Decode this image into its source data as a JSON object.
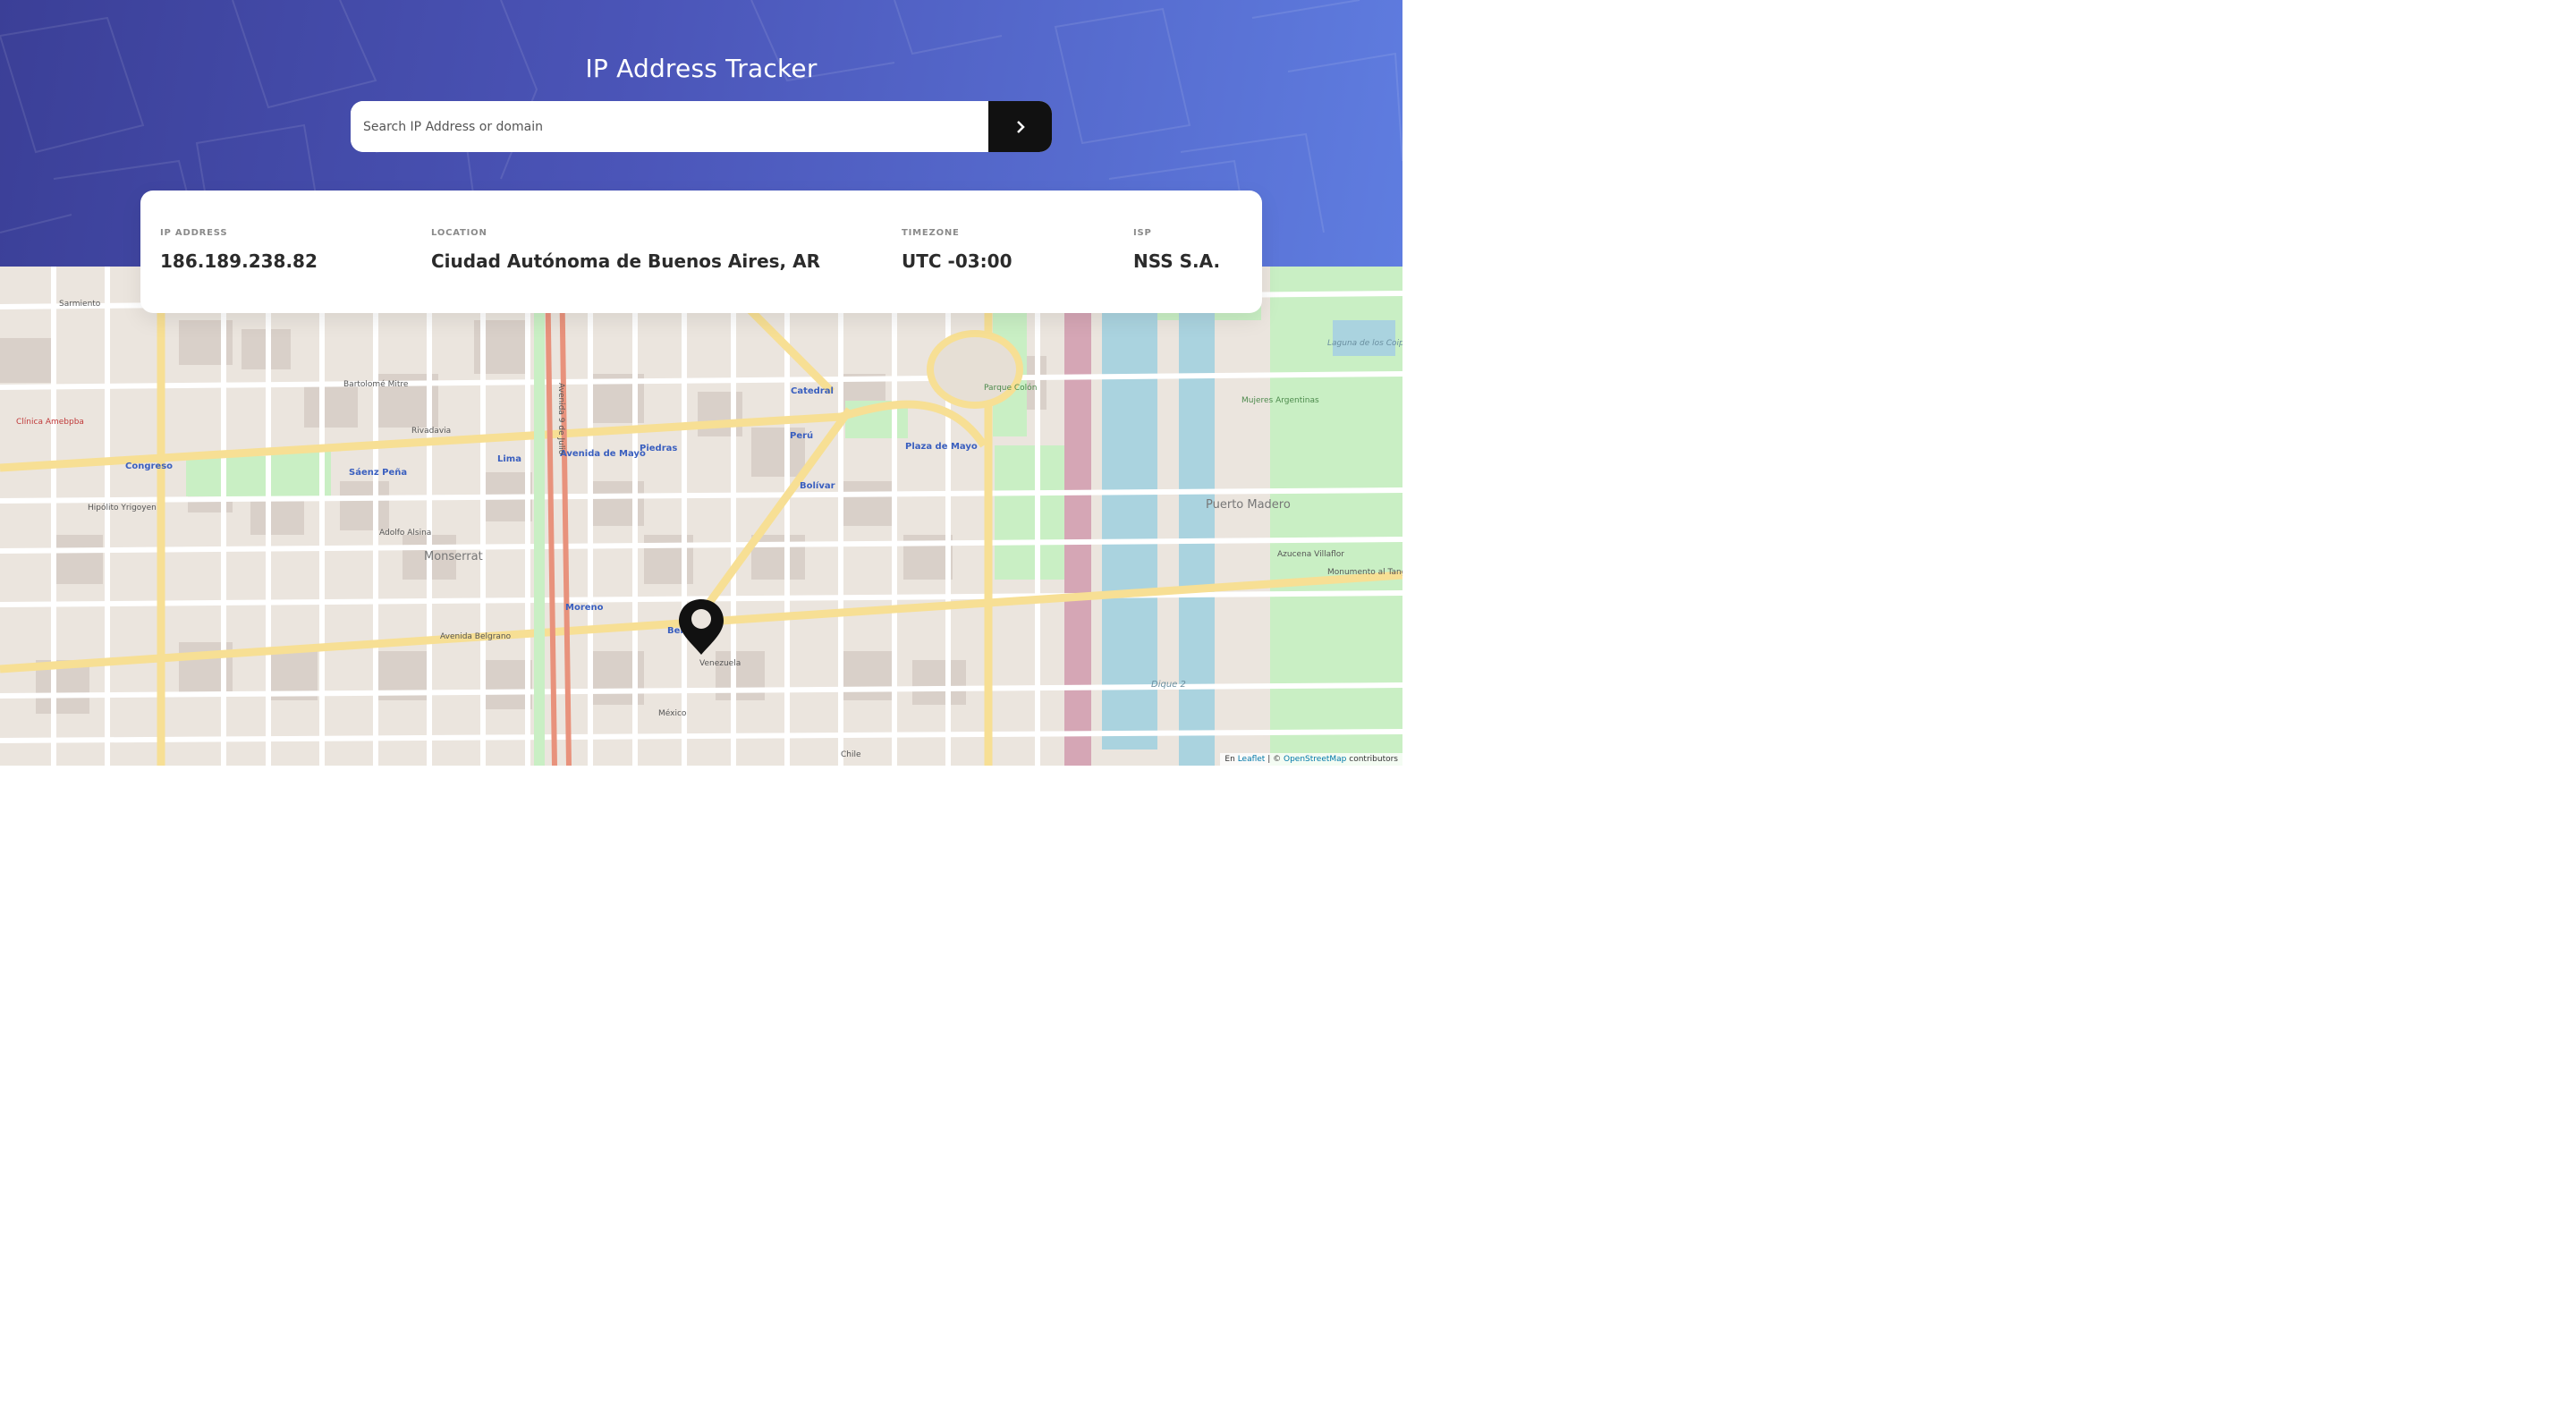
{
  "header": {
    "title": "IP Address Tracker",
    "search_placeholder": "Search IP Address or domain",
    "search_value": "",
    "submit_icon": "chevron-right-icon"
  },
  "info": {
    "ip": {
      "label": "IP Address",
      "value": "186.189.238.82"
    },
    "location": {
      "label": "Location",
      "value": "Ciudad Autónoma de Buenos Aires, AR"
    },
    "timezone": {
      "label": "Timezone",
      "value": "UTC -03:00"
    },
    "isp": {
      "label": "ISP",
      "value": "NSS S.A."
    }
  },
  "map": {
    "marker_icon": "location-pin-icon",
    "labels": {
      "monserrat": "Monserrat",
      "puerto_madero": "Puerto Madero",
      "dique2": "Dique 2",
      "congreso": "Congreso",
      "lima": "Lima",
      "piedras": "Piedras",
      "peru": "Perú",
      "bolivar": "Bolívar",
      "moreno": "Moreno",
      "catedral": "Catedral",
      "plaza_de_mayo": "Plaza de Mayo",
      "avenida_de_mayo": "Avenida de Mayo",
      "saenz_pena": "Sáenz Peña",
      "belgrano": "Belgrano",
      "avenida_belgrano": "Avenida Belgrano",
      "venezuela": "Venezuela",
      "mexico": "México",
      "chile": "Chile",
      "rivadavia": "Rivadavia",
      "hipolito_yrigoyen": "Hipólito Yrigoyen",
      "adolfo_alsina": "Adolfo Alsina",
      "bartolome_mitre": "Bartolomé Mitre",
      "azucena_villaflor": "Azucena Villaflor",
      "clinica": "Clínica Amebpba",
      "mujeres_argentinas": "Mujeres Argentinas",
      "laguna": "Laguna de los Coipos",
      "parque_colon": "Parque Colón",
      "monumento_tango": "Monumento al Tango",
      "sarmiento": "Sarmiento",
      "avenida_9_de_julio": "Avenida 9 de Julio"
    },
    "attribution": {
      "prefix": "En",
      "leaflet": "Leaflet",
      "separator": "| ©",
      "osm": "OpenStreetMap",
      "suffix": "contributors"
    }
  }
}
